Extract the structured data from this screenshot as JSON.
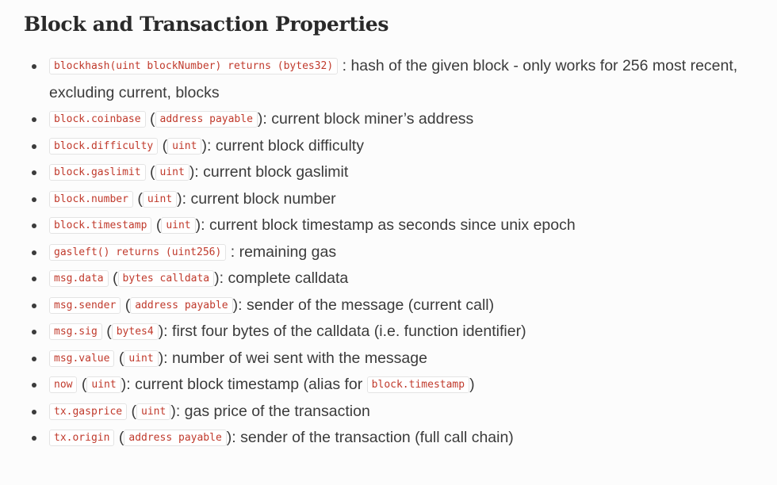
{
  "title": "Block and Transaction Properties",
  "items": [
    {
      "code": "blockhash(uint blockNumber) returns (bytes32)",
      "type": "",
      "description": ": hash of the given block - only works for 256 most recent, excluding current, blocks"
    },
    {
      "code": "block.coinbase",
      "type": "address payable",
      "description": "current block miner’s address"
    },
    {
      "code": "block.difficulty",
      "type": "uint",
      "description": "current block difficulty"
    },
    {
      "code": "block.gaslimit",
      "type": "uint",
      "description": "current block gaslimit"
    },
    {
      "code": "block.number",
      "type": "uint",
      "description": "current block number"
    },
    {
      "code": "block.timestamp",
      "type": "uint",
      "description": "current block timestamp as seconds since unix epoch"
    },
    {
      "code": "gasleft() returns (uint256)",
      "type": "",
      "description": ": remaining gas"
    },
    {
      "code": "msg.data",
      "type": "bytes calldata",
      "description": "complete calldata"
    },
    {
      "code": "msg.sender",
      "type": "address payable",
      "description": "sender of the message (current call)"
    },
    {
      "code": "msg.sig",
      "type": "bytes4",
      "description": "first four bytes of the calldata (i.e. function identifier)"
    },
    {
      "code": "msg.value",
      "type": "uint",
      "description": "number of wei sent with the message"
    },
    {
      "code": "now",
      "type": "uint",
      "description": "current block timestamp (alias for",
      "trailing_code": "block.timestamp",
      "trailing_text": ")"
    },
    {
      "code": "tx.gasprice",
      "type": "uint",
      "description": "gas price of the transaction"
    },
    {
      "code": "tx.origin",
      "type": "address payable",
      "description": "sender of the transaction (full call chain)"
    }
  ]
}
